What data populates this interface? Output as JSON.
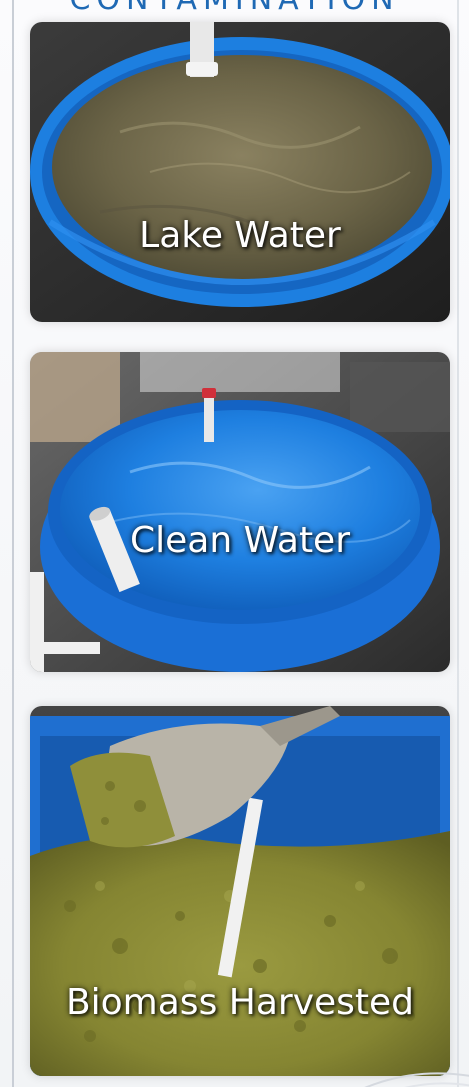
{
  "heading": {
    "text": "CONTAMINATION"
  },
  "panels": [
    {
      "caption": "Lake Water",
      "colors": {
        "water": "#6b6447",
        "tub": "#1d7fe0",
        "background": "#2a2a2a"
      }
    },
    {
      "caption": "Clean Water",
      "colors": {
        "water": "#1e7fe0",
        "tub": "#1a6fd6",
        "background": "#3a3a3a"
      }
    },
    {
      "caption": "Biomass Harvested",
      "colors": {
        "biomass": "#8a8a34",
        "tub": "#1f6fd0",
        "scoop": "#b9b4a8"
      }
    }
  ],
  "accent_color": "#1f69b4"
}
